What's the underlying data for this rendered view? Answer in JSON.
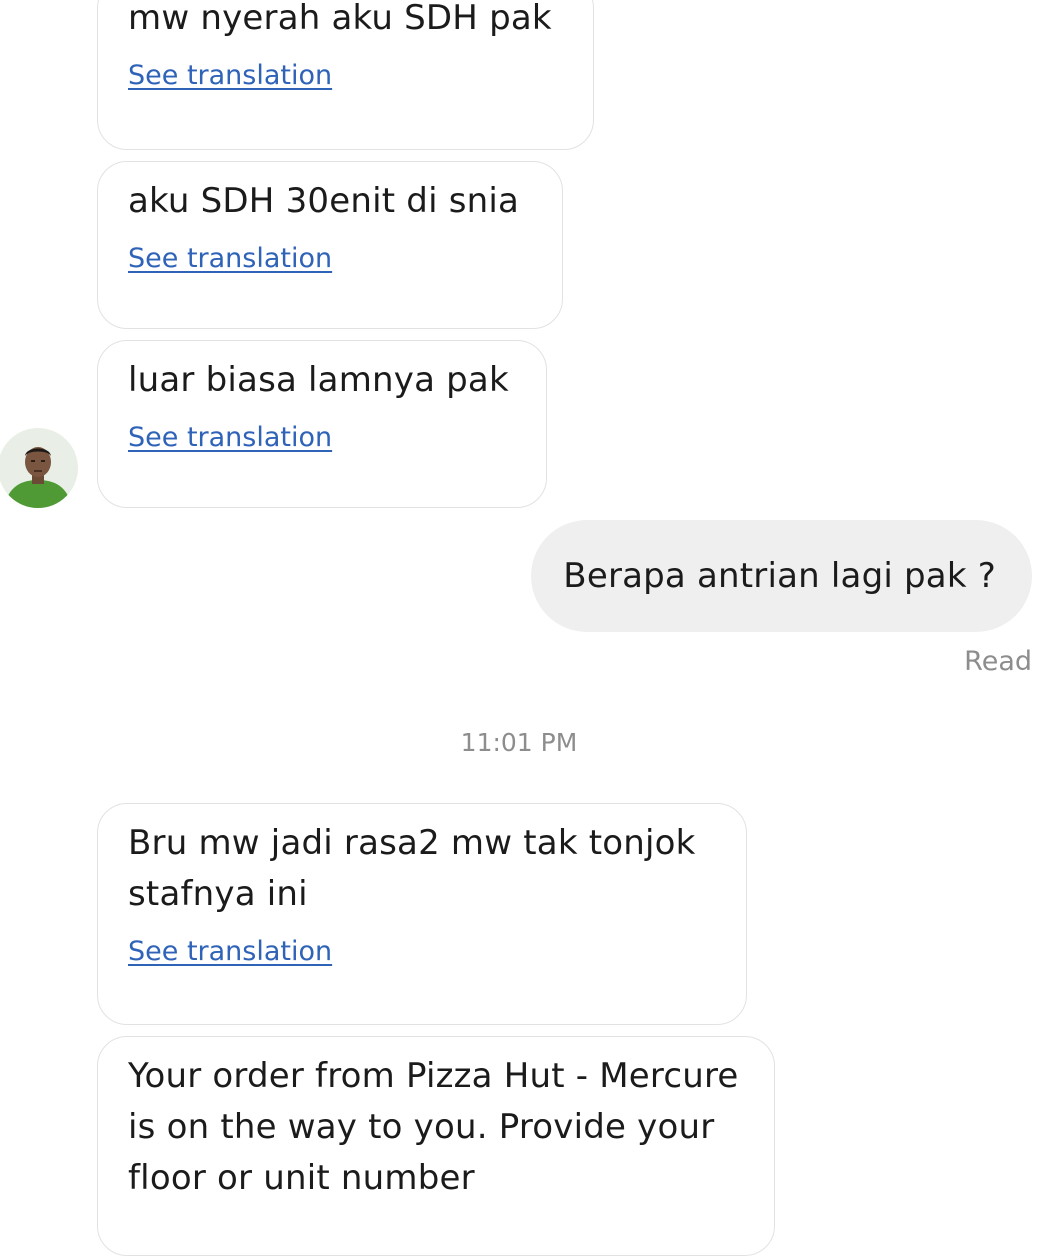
{
  "messages": [
    {
      "text": "mw nyerah aku SDH pak",
      "translate_label": "See translation"
    },
    {
      "text": "aku SDH 30enit di snia",
      "translate_label": "See translation"
    },
    {
      "text": "luar biasa lamnya pak",
      "translate_label": "See translation"
    },
    {
      "text": "Bru mw jadi rasa2 mw tak tonjok stafnya ini",
      "translate_label": "See translation"
    },
    {
      "text": "Your order from Pizza Hut - Mercure is on the way to you. Provide your floor or unit number"
    }
  ],
  "outgoing": {
    "text": "Berapa antrian lagi pak ?",
    "status": "Read"
  },
  "timestamp": "11:01 PM",
  "colors": {
    "link": "#2f63b8",
    "outgoing_bubble": "#efefef",
    "incoming_border": "#e2e2e2",
    "meta_text": "#8d8d8d"
  },
  "icons": {
    "avatar": "driver-avatar"
  }
}
